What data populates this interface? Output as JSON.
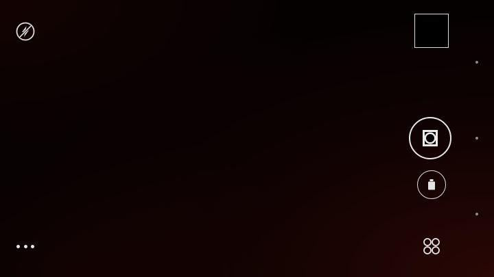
{
  "screen": {
    "type": "camera-viewfinder",
    "background_color": "#050101",
    "vignette_color": "#460c08"
  },
  "controls": {
    "flash": {
      "icon": "flash-off-icon",
      "state": "off"
    },
    "more": {
      "icon": "more-dots-icon"
    },
    "thumbnail": {
      "icon": "last-photo-thumbnail"
    },
    "shutter": {
      "icon": "camera-shutter-icon"
    },
    "video": {
      "icon": "video-camera-icon"
    },
    "modes": {
      "icon": "camera-modes-icon"
    }
  },
  "edge_indicators": {
    "count": 3,
    "color": "#8a8a8a"
  },
  "colors": {
    "icon": "#e8e8e8",
    "border": "#dcdcdc"
  }
}
